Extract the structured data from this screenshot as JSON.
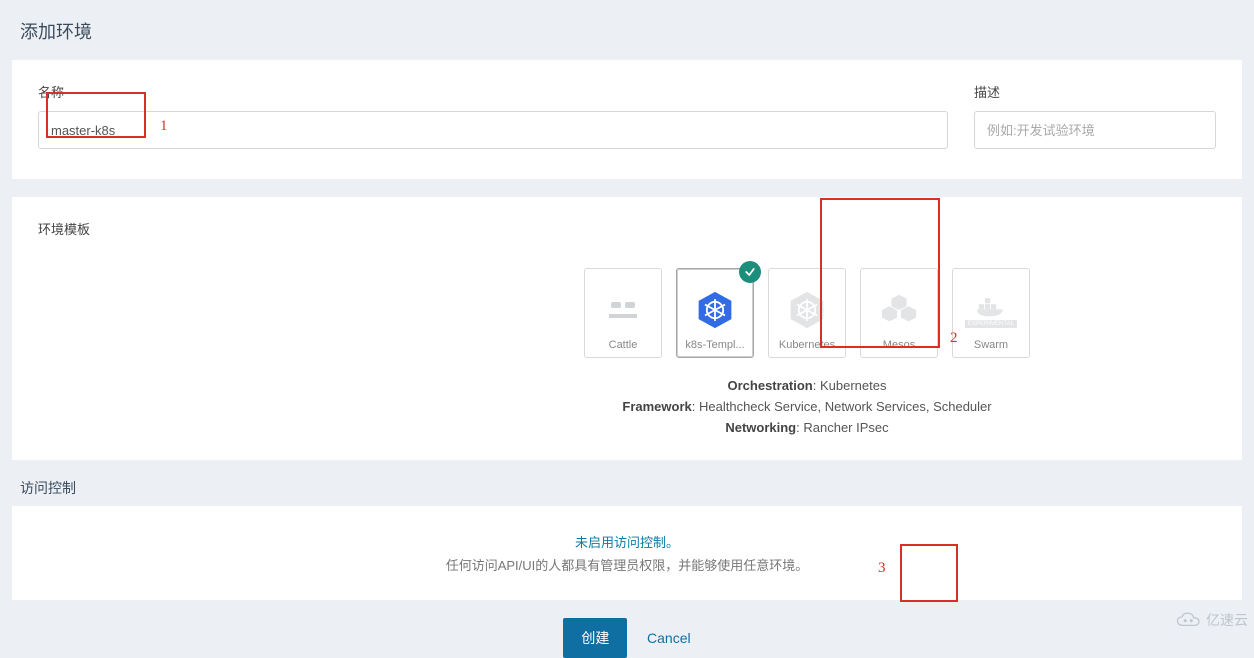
{
  "page": {
    "title": "添加环境"
  },
  "form": {
    "name_label": "名称",
    "name_value": "master-k8s",
    "desc_label": "描述",
    "desc_placeholder": "例如:开发试验环境"
  },
  "templates": {
    "label": "环境模板",
    "items": [
      {
        "id": "cattle",
        "label": "Cattle",
        "selected": false,
        "icon": "cattle-icon"
      },
      {
        "id": "k8s-templ",
        "label": "k8s-Templ...",
        "selected": true,
        "icon": "kubernetes-icon"
      },
      {
        "id": "kubernetes",
        "label": "Kubernetes",
        "selected": false,
        "icon": "kubernetes-icon"
      },
      {
        "id": "mesos",
        "label": "Mesos",
        "selected": false,
        "icon": "mesos-icon"
      },
      {
        "id": "swarm",
        "label": "Swarm",
        "selected": false,
        "icon": "swarm-icon",
        "experimental": true
      }
    ],
    "meta": {
      "orchestration_label": "Orchestration",
      "orchestration_value": "Kubernetes",
      "framework_label": "Framework",
      "framework_value": "Healthcheck Service, Network Services, Scheduler",
      "networking_label": "Networking",
      "networking_value": "Rancher IPsec"
    }
  },
  "access": {
    "section_title": "访问控制",
    "link_text": "未启用访问控制。",
    "sub_text": "任何访问API/UI的人都具有管理员权限，并能够使用任意环境。"
  },
  "actions": {
    "create": "创建",
    "cancel": "Cancel"
  },
  "annotations": {
    "a1": "1",
    "a2": "2",
    "a3": "3"
  },
  "watermark": {
    "text": "亿速云"
  }
}
